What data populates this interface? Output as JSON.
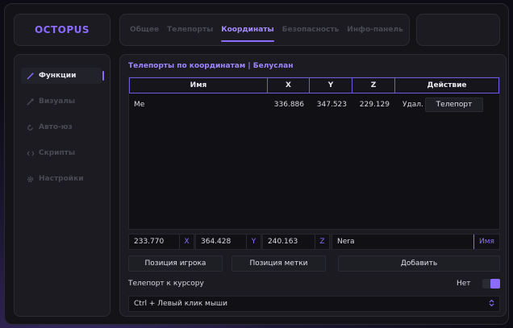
{
  "app": {
    "logo": "OCTOPUS"
  },
  "tabs": [
    {
      "label": "Общее"
    },
    {
      "label": "Телепорты"
    },
    {
      "label": "Координаты",
      "active": true
    },
    {
      "label": "Безопасность"
    },
    {
      "label": "Инфо-панель"
    }
  ],
  "sidebar": {
    "items": [
      {
        "label": "Функции",
        "icon": "wand-icon",
        "active": true
      },
      {
        "label": "Визуалы",
        "icon": "brush-icon"
      },
      {
        "label": "Авто-юз",
        "icon": "refresh-icon"
      },
      {
        "label": "Скрипты",
        "icon": "code-icon"
      },
      {
        "label": "Настройки",
        "icon": "gear-icon"
      }
    ]
  },
  "main": {
    "breadcrumb": "Телепорты по координатам | Белуслан",
    "table": {
      "columns": [
        "Имя",
        "X",
        "Y",
        "Z",
        "Действие"
      ],
      "rows": [
        {
          "name": "Me",
          "x": "336.886",
          "y": "347.523",
          "z": "229.129",
          "delete": "Удал.",
          "teleport": "Телепорт"
        }
      ]
    },
    "inputs": {
      "x": {
        "value": "233.770",
        "label": "X"
      },
      "y": {
        "value": "364.428",
        "label": "Y"
      },
      "z": {
        "value": "240.163",
        "label": "Z"
      },
      "name": {
        "value": "Nera",
        "label": "Имя"
      }
    },
    "buttons": {
      "player_pos": "Позиция игрока",
      "marker_pos": "Позиция метки",
      "add": "Добавить"
    },
    "cursor_teleport": {
      "label": "Телепорт к курсору",
      "value": "Нет",
      "enabled": true
    },
    "keybind": {
      "selected": "Ctrl + Левый клик мыши"
    }
  },
  "colors": {
    "accent": "#8c6cff",
    "background": "#141418"
  }
}
